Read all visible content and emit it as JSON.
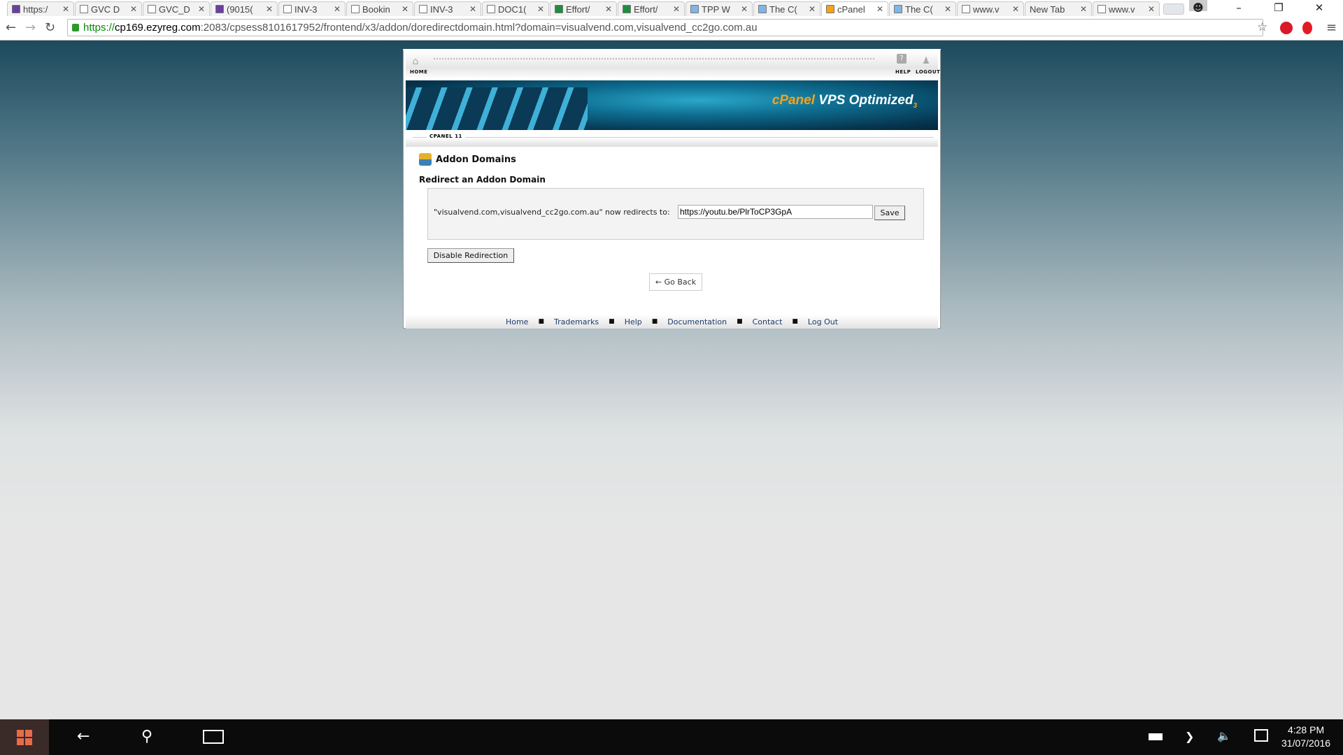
{
  "browser": {
    "tabs": [
      {
        "title": "https:/",
        "icon": "mail-icon",
        "active": false
      },
      {
        "title": "GVC D",
        "icon": "page-icon",
        "active": false
      },
      {
        "title": "GVC_D",
        "icon": "page-icon",
        "active": false
      },
      {
        "title": "(9015(",
        "icon": "mail-icon",
        "active": false
      },
      {
        "title": "INV-3",
        "icon": "page-icon",
        "active": false
      },
      {
        "title": "Bookin",
        "icon": "page-icon",
        "active": false
      },
      {
        "title": "INV-3",
        "icon": "page-icon",
        "active": false
      },
      {
        "title": "DOC1(",
        "icon": "page-icon",
        "active": false
      },
      {
        "title": "Effort/",
        "icon": "sheet-icon",
        "active": false
      },
      {
        "title": "Effort/",
        "icon": "sheet-icon",
        "active": false
      },
      {
        "title": "TPP W",
        "icon": "tpp-icon",
        "active": false
      },
      {
        "title": "The C(",
        "icon": "tpp-icon",
        "active": false
      },
      {
        "title": "cPanel",
        "icon": "cpanel-icon",
        "active": true
      },
      {
        "title": "The C(",
        "icon": "tpp-icon",
        "active": false
      },
      {
        "title": "www.v",
        "icon": "page-icon",
        "active": false
      },
      {
        "title": "New Tab",
        "icon": "",
        "active": false
      },
      {
        "title": "www.v",
        "icon": "page-icon",
        "active": false
      }
    ],
    "url": {
      "scheme": "https://",
      "host": "cp169.ezyreg.com",
      "rest": ":2083/cpsess8101617952/frontend/x3/addon/doredirectdomain.html?domain=visualvend.com,visualvend_cc2go.com.au"
    }
  },
  "cpanel": {
    "header": {
      "home": "HOME",
      "help": "HELP",
      "logout": "LOGOUT"
    },
    "banner": {
      "brand_c": "cPanel",
      "brand_rest": " VPS Optimized",
      "sub": "3"
    },
    "version": "CPANEL 11",
    "title": "Addon Domains",
    "subtitle": "Redirect an Addon Domain",
    "redirect_label": "\"visualvend.com,visualvend_cc2go.com.au\" now redirects to:",
    "redirect_value": "https://youtu.be/PlrToCP3GpA",
    "save": "Save",
    "disable": "Disable Redirection",
    "go_back": "← Go Back",
    "footer": [
      "Home",
      "Trademarks",
      "Help",
      "Documentation",
      "Contact",
      "Log Out"
    ]
  },
  "taskbar": {
    "time": "4:28 PM",
    "date": "31/07/2016"
  },
  "colors": {
    "accent": "#f6a21a",
    "link": "#1d3b6a",
    "url_green": "#0a8a0a"
  }
}
